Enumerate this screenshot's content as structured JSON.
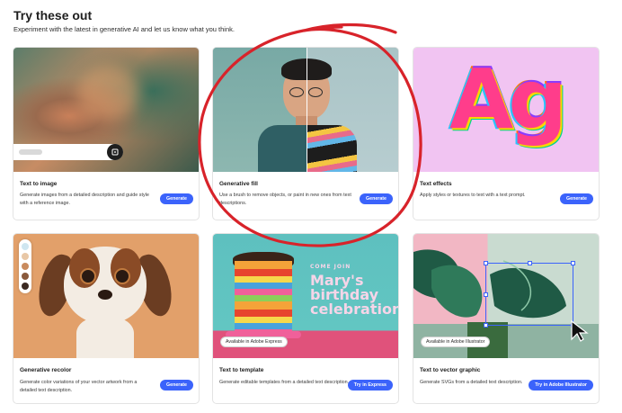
{
  "header": {
    "title": "Try these out",
    "subtitle": "Experiment with the latest in generative AI and let us know what you think."
  },
  "cards": [
    {
      "title": "Text to image",
      "description": "Generate images from a detailed description and guide style with a reference image.",
      "button": "Generate"
    },
    {
      "title": "Generative fill",
      "description": "Use a brush to remove objects, or paint in new ones from text descriptions.",
      "button": "Generate"
    },
    {
      "title": "Text effects",
      "description": "Apply styles or textures to text with a text prompt.",
      "button": "Generate",
      "preview_text": "Ag"
    },
    {
      "title": "Generative recolor",
      "description": "Generate color variations of your vector artwork from a detailed text description.",
      "button": "Generate"
    },
    {
      "title": "Text to template",
      "description": "Generate editable templates from a detailed text description.",
      "button": "Try in Express",
      "badge": "Available in Adobe Express",
      "preview_lines": [
        "COME JOIN",
        "Mary's",
        "birthday",
        "celebration"
      ]
    },
    {
      "title": "Text to vector graphic",
      "description": "Generate SVGs from a detailed text description.",
      "button": "Try in Adobe Illustrator",
      "badge": "Available in Adobe Illustrator"
    }
  ],
  "colors": {
    "accent": "#3b63fb",
    "annotation": "#d8232a",
    "recolor_swatches": [
      "#cfe6f0",
      "#e8c7a6",
      "#c98b5e",
      "#8a5a3c",
      "#3c2a22"
    ]
  },
  "icons": {
    "prompt_submit": "generate-icon",
    "cursor": "arrow-cursor-icon"
  }
}
